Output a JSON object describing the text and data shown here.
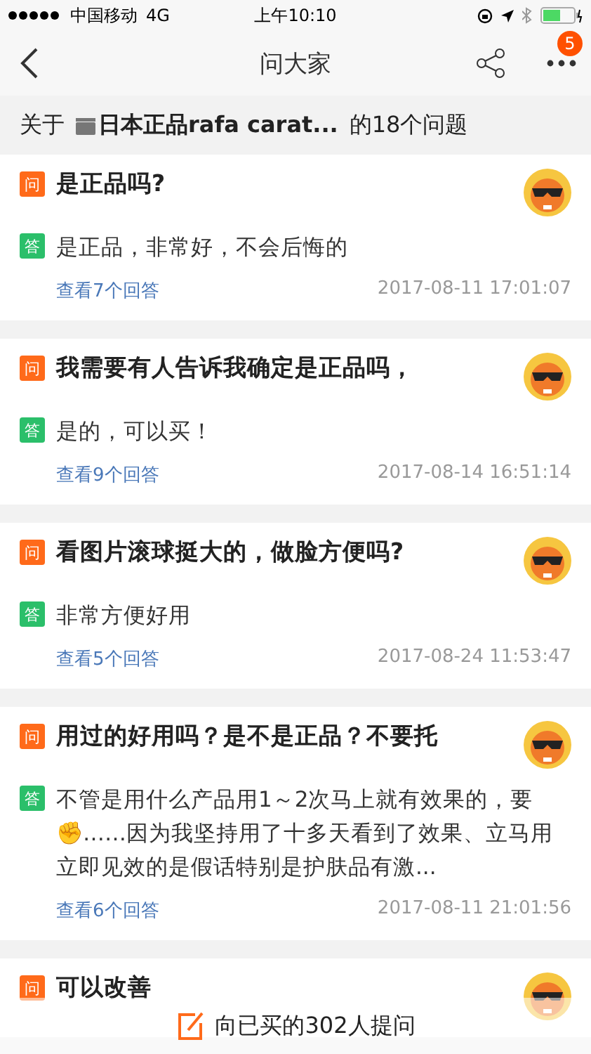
{
  "status_bar": {
    "carrier": "中国移动",
    "network": "4G",
    "time": "上午10:10"
  },
  "nav": {
    "title": "问大家",
    "badge": "5"
  },
  "header": {
    "prefix": "关于",
    "product": "日本正品rafa carat...",
    "suffix": "的18个问题"
  },
  "questions": [
    {
      "question_tag": "问",
      "answer_tag": "答",
      "question": "是正品吗?",
      "answer": "是正品，非常好，不会后悔的",
      "link": "查看7个回答",
      "time": "2017-08-11 17:01:07"
    },
    {
      "question_tag": "问",
      "answer_tag": "答",
      "question": "我需要有人告诉我确定是正品吗，",
      "answer": "是的，可以买！",
      "link": "查看9个回答",
      "time": "2017-08-14 16:51:14"
    },
    {
      "question_tag": "问",
      "answer_tag": "答",
      "question": "看图片滚球挺大的，做脸方便吗?",
      "answer": "非常方便好用",
      "link": "查看5个回答",
      "time": "2017-08-24 11:53:47"
    },
    {
      "question_tag": "问",
      "answer_tag": "答",
      "question": "用过的好用吗？是不是正品？不要托",
      "answer": "不管是用什么产品用1～2次马上就有效果的，要✊……因为我坚持用了十多天看到了效果、立马用立即见效的是假话特别是护肤品有激...",
      "link": "查看6个回答",
      "time": "2017-08-11 21:01:56"
    },
    {
      "question_tag": "问",
      "question": "可以改善"
    }
  ],
  "ask_button": {
    "label": "向已买的302人提问"
  }
}
